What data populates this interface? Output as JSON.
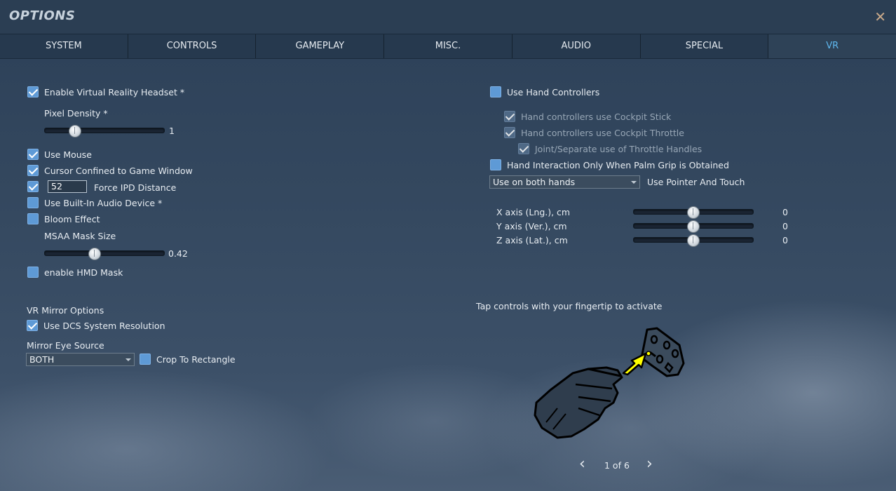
{
  "window": {
    "title": "OPTIONS",
    "close_glyph": "✕"
  },
  "tabs": [
    {
      "label": "SYSTEM"
    },
    {
      "label": "CONTROLS"
    },
    {
      "label": "GAMEPLAY"
    },
    {
      "label": "MISC."
    },
    {
      "label": "AUDIO"
    },
    {
      "label": "SPECIAL"
    },
    {
      "label": "VR"
    }
  ],
  "active_tab": "VR",
  "left": {
    "enable_vr": "Enable Virtual Reality Headset *",
    "pixel_density_label": "Pixel Density *",
    "pixel_density_value": "1",
    "pixel_density_level": 0.25,
    "use_mouse": "Use Mouse",
    "cursor_confined": "Cursor Confined to Game Window",
    "ipd_value": "52",
    "ipd_label": "Force IPD Distance",
    "builtin_audio": "Use Built-In Audio Device *",
    "bloom": "Bloom Effect",
    "msaa_label": "MSAA Mask Size",
    "msaa_value": "0.42",
    "msaa_level": 0.42,
    "hmd_mask": "enable HMD Mask",
    "mirror_header": "VR Mirror Options",
    "dcs_resolution": "Use DCS System Resolution",
    "mirror_eye_label": "Mirror Eye Source",
    "mirror_eye_value": "BOTH",
    "crop_rect": "Crop To Rectangle"
  },
  "right": {
    "hand_controllers": "Use Hand Controllers",
    "cockpit_stick": "Hand controllers use Cockpit Stick",
    "cockpit_throttle": "Hand controllers use Cockpit Throttle",
    "throttle_handles": "Joint/Separate use of Throttle Handles",
    "palm_grip": "Hand Interaction Only When Palm Grip is Obtained",
    "hands_select": "Use on both hands",
    "pointer_touch": "Use Pointer And Touch",
    "x_axis": "X axis (Lng.), cm",
    "x_value": "0",
    "y_axis": "Y axis (Ver.), cm",
    "y_value": "0",
    "z_axis": "Z axis (Lat.), cm",
    "z_value": "0",
    "axis_level": 0.5,
    "tip": "Tap controls with your fingertip to activate",
    "pager": "1 of 6",
    "prev_glyph": "‹",
    "next_glyph": "›"
  },
  "colors": {
    "accent": "#5fb8ef",
    "checkbox": "#5e9ad6",
    "close": "#c9a98a",
    "pointer_arrow": "#ffff00"
  },
  "icons": [
    "close-icon",
    "checkmark-icon",
    "hand-glove-icon",
    "controller-panel-icon",
    "pointer-arrow-icon",
    "chevron-left-icon",
    "chevron-right-icon"
  ]
}
